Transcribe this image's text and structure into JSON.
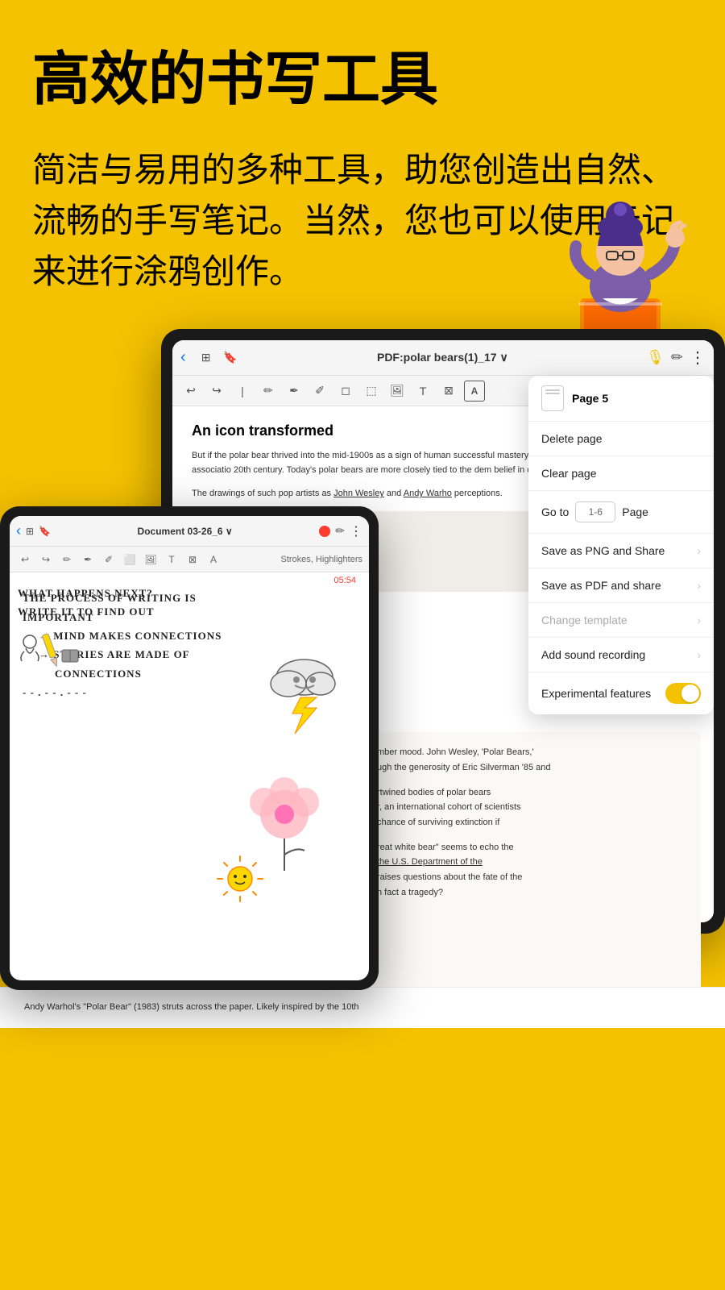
{
  "page": {
    "background_color": "#F5C200"
  },
  "hero": {
    "title": "高效的书写工具",
    "subtitle": "简洁与易用的多种工具，助您创造出自然、流畅的手写笔记。当然，您也可以使用云记来进行涂鸦创作。"
  },
  "tablet_main": {
    "toolbar": {
      "back_icon": "‹",
      "grid_icon": "⊞",
      "bookmark_icon": "🔖",
      "title": "PDF:polar bears(1)_17",
      "dropdown_arrow": "∨",
      "mic_icon": "🎙",
      "pen_icon": "✏",
      "more_icon": "⋮"
    },
    "tools": [
      "↩",
      "↪",
      "|",
      "✏",
      "✒",
      "✐",
      "⬜",
      "☐",
      "▭",
      "⊠",
      "A"
    ],
    "doc": {
      "title": "An icon transformed",
      "body1": "But if the polar bear thrived into the mid-1900s as a sign of human successful mastery of antagonistic forces, this symbolic associatio 20th century. Today's polar bears are more closely tied to the dem belief in conquest and domination.",
      "body2": "The drawings of such pop artists as John Wesley and Andy Warho perceptions."
    }
  },
  "dropdown_menu": {
    "page_label": "Page 5",
    "items": [
      {
        "label": "Delete page",
        "type": "normal"
      },
      {
        "label": "Clear page",
        "type": "normal"
      },
      {
        "label": "Go to",
        "type": "goto",
        "placeholder": "1-6",
        "suffix": "Page"
      },
      {
        "label": "Save as PNG and Share",
        "type": "arrow"
      },
      {
        "label": "Save as PDF and share",
        "type": "arrow"
      },
      {
        "label": "Change template",
        "type": "arrow_disabled"
      },
      {
        "label": "Add sound recording",
        "type": "arrow"
      },
      {
        "label": "Experimental features",
        "type": "toggle"
      }
    ]
  },
  "tablet_second": {
    "toolbar": {
      "title": "Document 03-26_6",
      "dropdown_arrow": "∨",
      "more_icon": "⋮",
      "pen_icon": "✏"
    },
    "timer": "05:54",
    "stroke_label": "Strokes, Highlighters",
    "handwriting_lines": [
      "THE PROCESS OF WRITING IS",
      "IMPORTANT",
      "→ MIND MAKES CONNECTIONS",
      "→ STORIES ARE MADE OF",
      "   CONNECTIONS",
      "- - . - - . - - -",
      "WHAT HAPPENS NEXT?",
      "WRITE IT TO FIND OUT"
    ]
  },
  "bottom_doc": {
    "paragraph1": "mber mood. John Wesley, 'Polar Bears,' ugh the generosity of Eric Silverman '85 and",
    "paragraph2": "rtwined bodies of polar bears r, an international cohort of scientists chance of surviving extinction if",
    "paragraph3": "reat white bear\" seems to echo the he U.S. Department of the raises questions about the fate of the n fact a tragedy?",
    "paragraph4": "Andy Warhol's \"Polar Bear\" (1983) struts across the paper. Likely inspired by the 10th",
    "department_text": "Department of the"
  }
}
